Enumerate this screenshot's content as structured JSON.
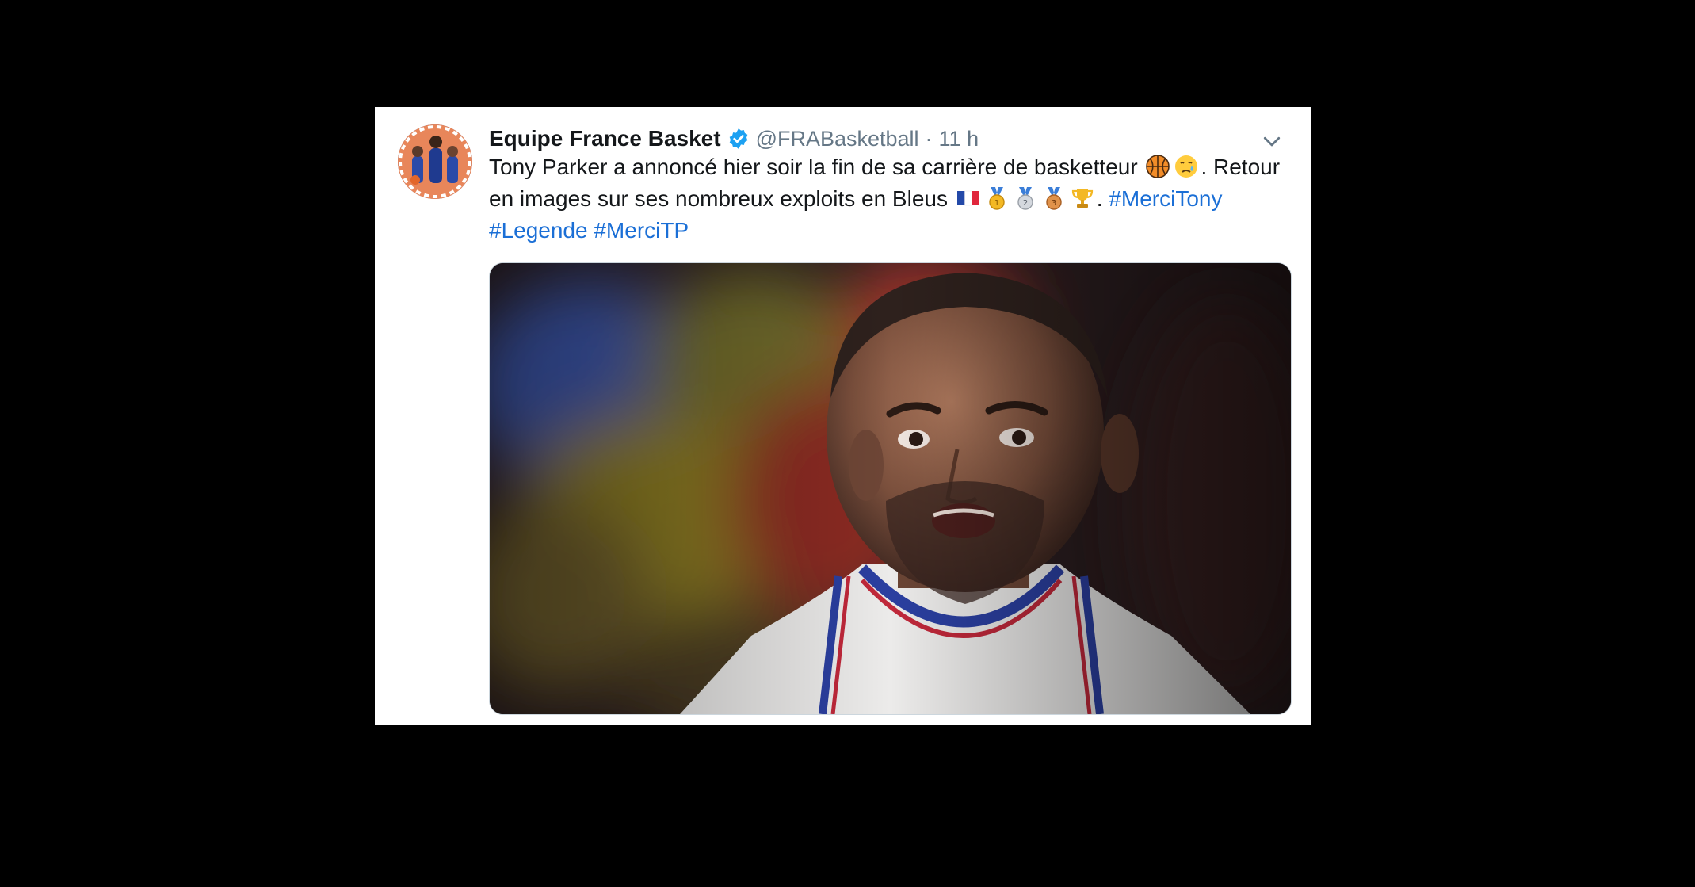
{
  "tweet": {
    "display_name": "Equipe France Basket",
    "handle": "@FRABasketball",
    "separator": "·",
    "time": "11 h",
    "text_line1": "Tony Parker a annoncé hier soir la fin de sa carrière de basketteur",
    "text_line1_end": ". Retour",
    "text_line2_start": "en images sur ses nombreux exploits en Bleus",
    "text_line2_end": ".",
    "hashtags": [
      "#MerciTony",
      "#Legende",
      "#MerciTP"
    ]
  },
  "icons": {
    "verified": "verified-badge-icon",
    "menu": "chevron-down-icon",
    "emojis": [
      "basketball-emoji",
      "crying-face-emoji",
      "france-flag-emoji",
      "gold-medal-emoji",
      "silver-medal-emoji",
      "bronze-medal-emoji",
      "trophy-emoji"
    ]
  },
  "colors": {
    "background": "#000000",
    "card": "#ffffff",
    "text": "#14171a",
    "secondary": "#657786",
    "link": "#1b6fd6",
    "verified": "#1da1f2"
  }
}
